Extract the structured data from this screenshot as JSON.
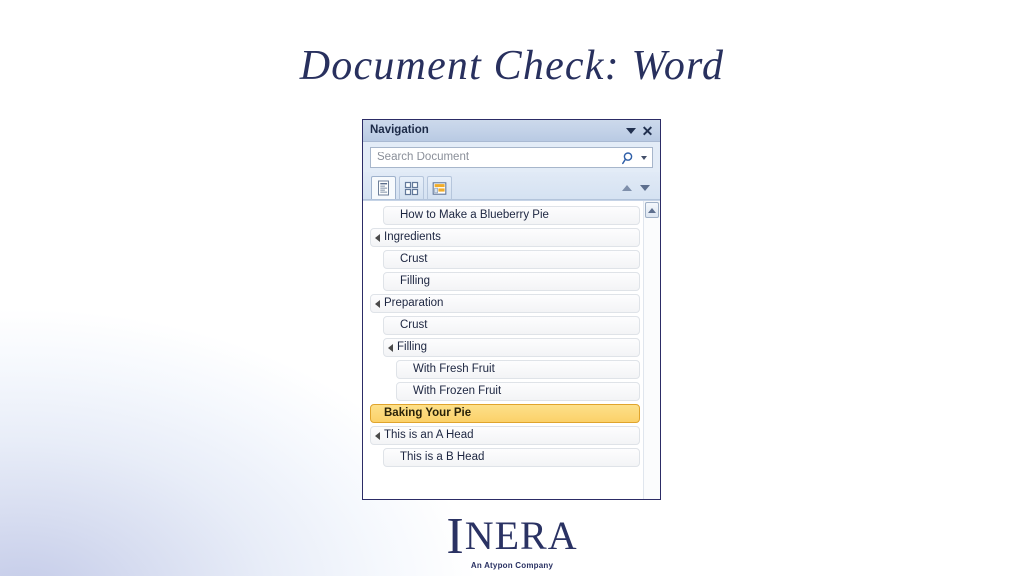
{
  "slide": {
    "title": "Document Check: Word",
    "title_color": "#28305e",
    "background_accent": "#c3cae8"
  },
  "nav_pane": {
    "titlebar": {
      "title": "Navigation",
      "dropdown_icon": "caret-down-icon",
      "close_icon": "close-icon"
    },
    "search": {
      "placeholder": "Search Document",
      "value": "",
      "search_icon": "magnifier-icon",
      "options_icon": "caret-down-icon"
    },
    "tabs": [
      {
        "name": "headings",
        "icon": "headings-list-icon",
        "active": true
      },
      {
        "name": "pages",
        "icon": "thumbnail-grid-icon",
        "active": false
      },
      {
        "name": "results",
        "icon": "search-results-icon",
        "active": false
      }
    ],
    "nav_buttons": {
      "previous_icon": "triangle-up-icon",
      "next_icon": "triangle-down-icon"
    },
    "scrollbar": {
      "up_icon": "scroll-up-arrow-icon"
    },
    "headings": [
      {
        "label": "How to Make a Blueberry Pie",
        "level": 0,
        "twisty": false,
        "selected": false
      },
      {
        "label": "Ingredients",
        "level": 1,
        "twisty": true,
        "selected": false
      },
      {
        "label": "Crust",
        "level": 2,
        "twisty": false,
        "selected": false
      },
      {
        "label": "Filling",
        "level": 2,
        "twisty": false,
        "selected": false
      },
      {
        "label": "Preparation",
        "level": 1,
        "twisty": true,
        "selected": false
      },
      {
        "label": "Crust",
        "level": 2,
        "twisty": false,
        "selected": false
      },
      {
        "label": "Filling",
        "level": 2,
        "twisty": true,
        "selected": false
      },
      {
        "label": "With Fresh Fruit",
        "level": 3,
        "twisty": false,
        "selected": false
      },
      {
        "label": "With Frozen Fruit",
        "level": 3,
        "twisty": false,
        "selected": false
      },
      {
        "label": "Baking Your Pie",
        "level": 1,
        "twisty": false,
        "selected": true
      },
      {
        "label": "This is an A Head",
        "level": 1,
        "twisty": true,
        "selected": false
      },
      {
        "label": "This is a B Head",
        "level": 2,
        "twisty": false,
        "selected": false
      }
    ],
    "selected_color": "#fbd169",
    "selected_border": "#e0a42c"
  },
  "logo": {
    "initial": "I",
    "rest": "NERA",
    "tagline": "An Atypon Company",
    "color": "#2a3263"
  }
}
